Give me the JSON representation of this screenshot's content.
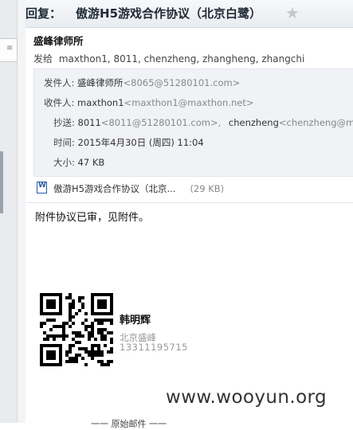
{
  "email": {
    "subject_prefix": "回复：",
    "subject": "傲游H5游戏合作协议（北京白鹭）",
    "sender_name": "盛峰律师所",
    "send_to_label": "发给",
    "send_to_list": "maxthon1, 8011, chenzheng, zhangheng, zhangchi"
  },
  "details": {
    "from_label": "发件人:",
    "from_name": "盛峰律师所",
    "from_email": "<8065@51280101.com>",
    "to_label": "收件人:",
    "to_name": "maxthon1",
    "to_email": "<maxthon1@maxthon.net>",
    "cc_label": "抄送:",
    "cc_name1": "8011",
    "cc_email1": "<8011@51280101.com>,",
    "cc_name2": "chenzheng",
    "cc_email2": "<chenzheng@ma",
    "time_label": "时间:",
    "time_value": "2015年4月30日 (周四) 11:04",
    "size_label": "大小:",
    "size_value": "47 KB"
  },
  "attachment": {
    "icon": "word-document-icon",
    "name": "傲游H5游戏合作协议（北京...",
    "size": "(29 KB)"
  },
  "body": {
    "text": "附件协议已审，见附件。"
  },
  "signature": {
    "name": "韩明辉",
    "company": "北京盛峰",
    "phone": "13311195715"
  },
  "bottom_cut_text": "一一 原始邮件 一一",
  "watermark": "www.wooyun.org",
  "icons": {
    "star": "star-icon",
    "nav": "menu-icon"
  },
  "colors": {
    "header_bg": "#eceff2",
    "details_bg": "#f0f2f5",
    "email_gray": "#888888",
    "star_gray": "#c4c8cd"
  }
}
